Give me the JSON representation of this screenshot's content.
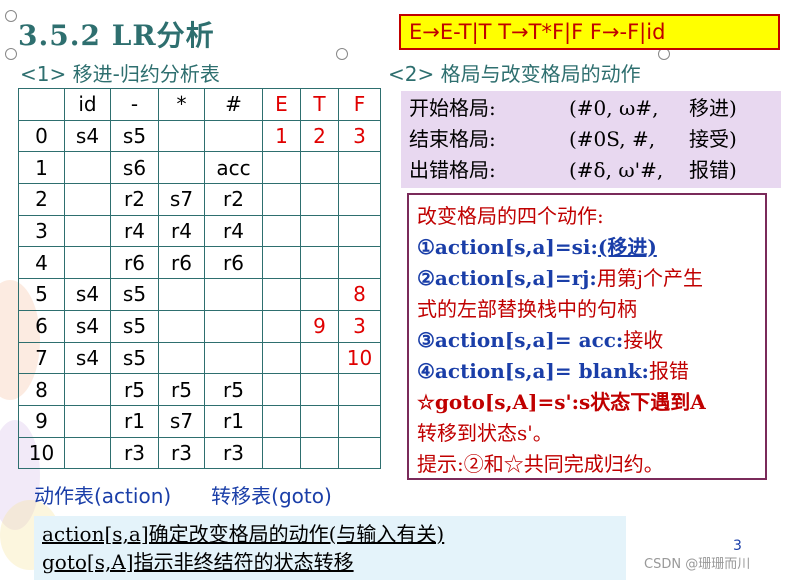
{
  "title": "3.5.2 LR分析",
  "grammar": "E→E-T|T  T→T*F|F  F→-F|id",
  "subtitle_left": "<1> 移进-归约分析表",
  "subtitle_right": "<2> 格局与改变格局的动作",
  "table": {
    "headers": [
      "",
      "id",
      "-",
      "*",
      "#",
      "E",
      "T",
      "F"
    ],
    "rows": [
      [
        "0",
        "s4",
        "s5",
        "",
        "",
        "1",
        "2",
        "3"
      ],
      [
        "1",
        "",
        "s6",
        "",
        "acc",
        "",
        "",
        ""
      ],
      [
        "2",
        "",
        "r2",
        "s7",
        "r2",
        "",
        "",
        ""
      ],
      [
        "3",
        "",
        "r4",
        "r4",
        "r4",
        "",
        "",
        ""
      ],
      [
        "4",
        "",
        "r6",
        "r6",
        "r6",
        "",
        "",
        ""
      ],
      [
        "5",
        "s4",
        "s5",
        "",
        "",
        "",
        "",
        "8"
      ],
      [
        "6",
        "s4",
        "s5",
        "",
        "",
        "",
        "9",
        "3"
      ],
      [
        "7",
        "s4",
        "s5",
        "",
        "",
        "",
        "",
        "10"
      ],
      [
        "8",
        "",
        "r5",
        "r5",
        "r5",
        "",
        "",
        ""
      ],
      [
        "9",
        "",
        "r1",
        "s7",
        "r1",
        "",
        "",
        ""
      ],
      [
        "10",
        "",
        "r3",
        "r3",
        "r3",
        "",
        "",
        ""
      ]
    ]
  },
  "configs": [
    {
      "label": "开始格局:",
      "value": "(#0, ω#,",
      "action": "移进)"
    },
    {
      "label": "结束格局:",
      "value": "(#0S, #,",
      "action": "接受)"
    },
    {
      "label": "出错格局:",
      "value": "(#δ, ω'#,",
      "action": "报错)"
    }
  ],
  "actions": {
    "heading": "改变格局的四个动作:",
    "a1_code": "①action[s,a]=si:",
    "a1_text": "(移进)",
    "a2_code": "②action[s,a]=rj:",
    "a2_text": "用第j个产生",
    "a2_cont": "式的左部替换栈中的句柄",
    "a3_code": "③action[s,a]= acc:",
    "a3_text": "接收",
    "a4_code": "④action[s,a]= blank:",
    "a4_text": "报错",
    "goto_code": "☆goto[s,A]=s':",
    "goto_text": "s状态下遇到A",
    "goto_cont": "转移到状态s'。",
    "hint": "提示:②和☆共同完成归约。"
  },
  "labels": {
    "action_table": "动作表(action)",
    "goto_table": "转移表(goto)"
  },
  "bottom": {
    "line1": "action[s,a]确定改变格局的动作(与输入有关)",
    "line2": "goto[s,A]指示非终结符的状态转移"
  },
  "page_number": "3",
  "watermark": "CSDN @珊珊而川",
  "colors": {
    "title": "#2e6f6f",
    "red": "#e00000",
    "blue": "#1a3ea8",
    "yellow": "#ffff00",
    "config_bg": "#e8d8f0",
    "bottom_bg": "#e4f3fa"
  }
}
